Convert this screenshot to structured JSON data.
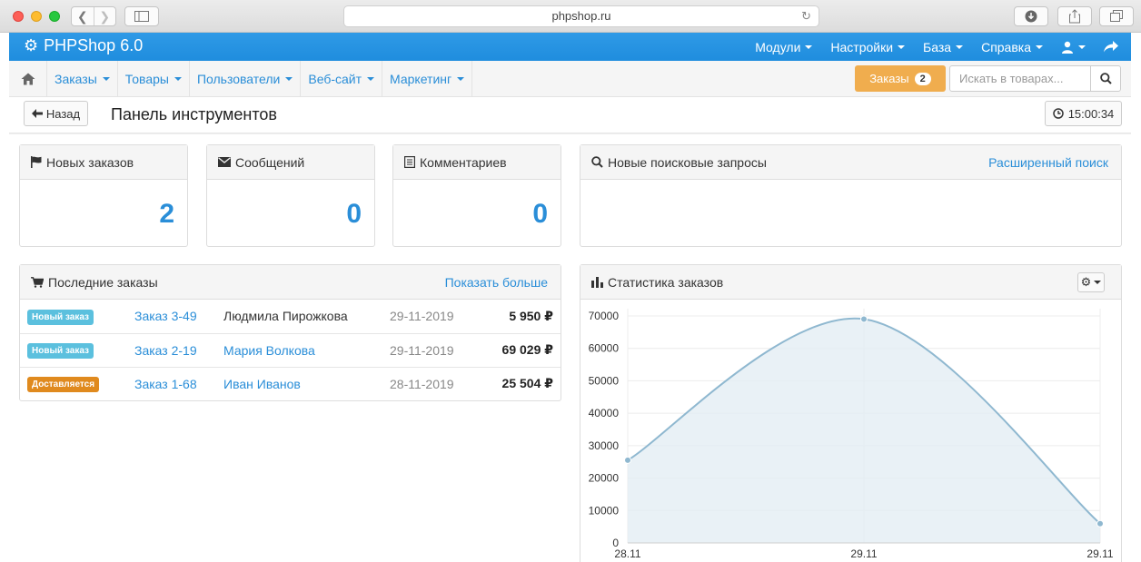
{
  "browser": {
    "url": "phpshop.ru"
  },
  "topbar": {
    "brand": "PHPShop 6.0",
    "menu": [
      {
        "label": "Модули"
      },
      {
        "label": "Настройки"
      },
      {
        "label": "База"
      },
      {
        "label": "Справка"
      }
    ]
  },
  "subnav": {
    "menu": [
      {
        "label": "Заказы"
      },
      {
        "label": "Товары"
      },
      {
        "label": "Пользователи"
      },
      {
        "label": "Веб-сайт"
      },
      {
        "label": "Маркетинг"
      }
    ],
    "orders_button": {
      "label": "Заказы",
      "count": "2"
    },
    "search_placeholder": "Искать в товарах..."
  },
  "pagehead": {
    "back_label": "Назад",
    "title": "Панель инструментов",
    "time": "15:00:34"
  },
  "stats": {
    "new_orders": {
      "label": "Новых заказов",
      "value": "2"
    },
    "messages": {
      "label": "Сообщений",
      "value": "0"
    },
    "comments": {
      "label": "Комментариев",
      "value": "0"
    }
  },
  "search_panel": {
    "title": "Новые поисковые запросы",
    "link": "Расширенный поиск"
  },
  "orders_panel": {
    "title": "Последние заказы",
    "more_link": "Показать больше",
    "rows": [
      {
        "status": "Новый заказ",
        "status_color": "#5bc0de",
        "order": "Заказ 3-49",
        "customer": "Людмила Пирожкова",
        "customer_link": false,
        "date": "29-11-2019",
        "amount": "5 950",
        "currency": "₽"
      },
      {
        "status": "Новый заказ",
        "status_color": "#5bc0de",
        "order": "Заказ 2-19",
        "customer": "Мария Волкова",
        "customer_link": true,
        "date": "29-11-2019",
        "amount": "69 029",
        "currency": "₽"
      },
      {
        "status": "Доставляется",
        "status_color": "#e08a1e",
        "order": "Заказ 1-68",
        "customer": "Иван Иванов",
        "customer_link": true,
        "date": "28-11-2019",
        "amount": "25 504",
        "currency": "₽"
      }
    ]
  },
  "chart_panel": {
    "title": "Статистика заказов"
  },
  "chart_data": {
    "type": "area",
    "categories": [
      "28.11",
      "29.11",
      "29.11"
    ],
    "values": [
      25504,
      69029,
      5950
    ],
    "ylim": [
      0,
      70000
    ],
    "yticks": [
      "0",
      "10000",
      "20000",
      "30000",
      "40000",
      "50000",
      "60000",
      "70000"
    ],
    "grid": true,
    "line_color": "#8fb8d0",
    "fill_color": "#e4eef4"
  }
}
